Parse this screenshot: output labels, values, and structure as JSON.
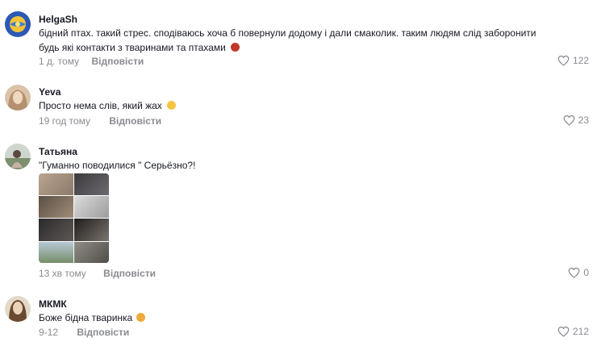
{
  "comments": [
    {
      "username": "HelgaSh",
      "text": "бідний птах. такий стрес. сподіваюсь хоча б повернули додому і дали смаколик. таким людям слід заборонити будь які контакти з тваринами та птахами",
      "emoji": "angry-face-emoji",
      "time": "1 д. тому",
      "reply_label": "Відповісти",
      "likes": "122",
      "avatar": "globe-avatar"
    },
    {
      "username": "Yeva",
      "text": "Просто нема слів, який жах",
      "emoji": "shocked-face-emoji",
      "time": "19 год тому",
      "reply_label": "Відповісти",
      "likes": "23",
      "avatar": "portrait-avatar"
    },
    {
      "username": "Татьяна",
      "text": "\"Гуманно поводилися \" Серьёзно?!",
      "time": "13 хв тому",
      "reply_label": "Відповісти",
      "likes": "0",
      "avatar": "photo-avatar",
      "has_image": true
    },
    {
      "username": "МКМК",
      "text": "Боже бідна тваринка",
      "emoji": "crying-cat-emoji",
      "time": "9-12",
      "reply_label": "Відповісти",
      "likes": "212",
      "avatar": "portrait-avatar"
    }
  ],
  "colors": {
    "text": "#161823",
    "muted": "#8a8b91",
    "background": "#ffffff"
  }
}
